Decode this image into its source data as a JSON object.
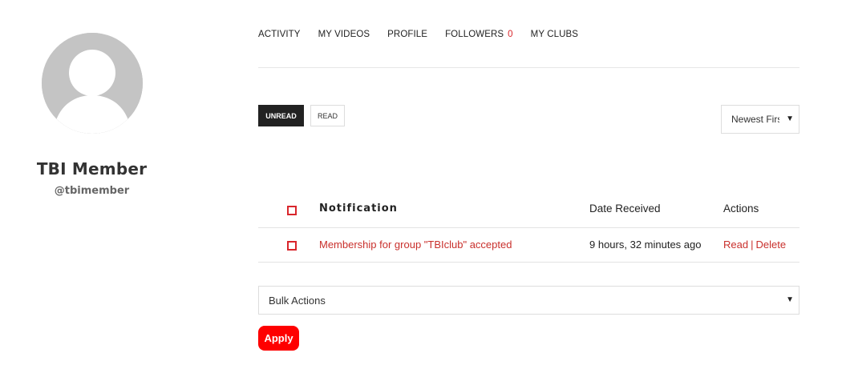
{
  "profile": {
    "name": "TBI Member",
    "handle": "@tbimember"
  },
  "nav": {
    "items": [
      {
        "label": "ACTIVITY"
      },
      {
        "label": "MY VIDEOS"
      },
      {
        "label": "PROFILE"
      },
      {
        "label": "FOLLOWERS",
        "count": "0"
      },
      {
        "label": "MY CLUBS"
      }
    ]
  },
  "filters": {
    "unread_label": "UNREAD",
    "read_label": "READ"
  },
  "sort": {
    "selected": "Newest First"
  },
  "table": {
    "headers": {
      "notification": "Notification",
      "date": "Date Received",
      "actions": "Actions"
    },
    "rows": [
      {
        "notification": "Membership for group \"TBIclub\" accepted",
        "date": "9 hours, 32 minutes ago",
        "action_read": "Read",
        "action_sep": "|",
        "action_delete": "Delete"
      }
    ]
  },
  "bulk": {
    "selected": "Bulk Actions",
    "apply_label": "Apply"
  },
  "colors": {
    "accent": "#d9262c",
    "apply": "#fe0000",
    "avatar": "#c4c4c4"
  },
  "icons": {
    "avatar": "user-silhouette-icon",
    "dropdown": "caret-down-icon"
  }
}
